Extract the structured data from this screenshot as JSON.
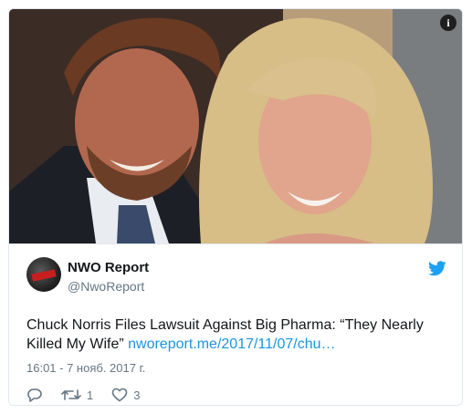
{
  "media": {
    "info_icon": "info-icon"
  },
  "author": {
    "name": "NWO Report",
    "handle": "@NwoReport",
    "avatar_text": "NWO REPORT"
  },
  "tweet": {
    "text": "Chuck Norris Files Lawsuit Against Big Pharma: “They Nearly Killed My Wife” ",
    "link": "nworeport.me/2017/11/07/chu…",
    "timestamp": "16:01 - 7 нояб. 2017 г."
  },
  "actions": {
    "reply_count": "",
    "retweet_count": "1",
    "like_count": "3"
  },
  "colors": {
    "link": "#1b95e0",
    "twitter_blue": "#1da1f2",
    "muted": "#657786"
  }
}
